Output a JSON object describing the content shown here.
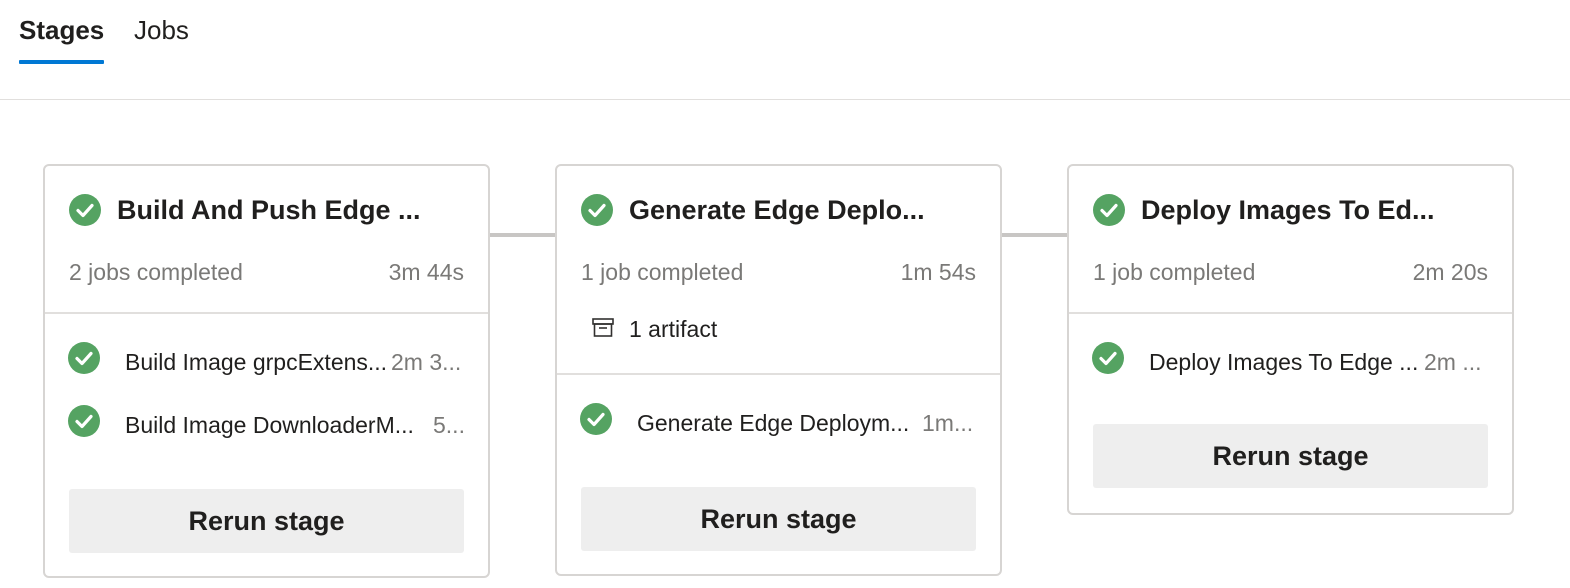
{
  "tabs": [
    {
      "label": "Stages",
      "active": true
    },
    {
      "label": "Jobs",
      "active": false
    }
  ],
  "colors": {
    "accent": "#0078d4",
    "success": "#55a362"
  },
  "stages": [
    {
      "title": "Build And Push Edge ...",
      "status": "succeeded",
      "summary": "2 jobs completed",
      "duration": "3m 44s",
      "jobs": [
        {
          "name": "Build Image grpcExtens...",
          "duration": "2m 3..."
        },
        {
          "name": "Build Image DownloaderM...",
          "duration": "5..."
        }
      ],
      "rerun_label": "Rerun stage"
    },
    {
      "title": "Generate Edge Deplo...",
      "status": "succeeded",
      "summary": "1 job completed",
      "duration": "1m 54s",
      "artifact": "1 artifact",
      "jobs": [
        {
          "name": "Generate Edge Deploym...",
          "duration": "1m..."
        }
      ],
      "rerun_label": "Rerun stage"
    },
    {
      "title": "Deploy Images To Ed...",
      "status": "succeeded",
      "summary": "1 job completed",
      "duration": "2m 20s",
      "jobs": [
        {
          "name": "Deploy Images To Edge ...",
          "duration": "2m ..."
        }
      ],
      "rerun_label": "Rerun stage"
    }
  ]
}
